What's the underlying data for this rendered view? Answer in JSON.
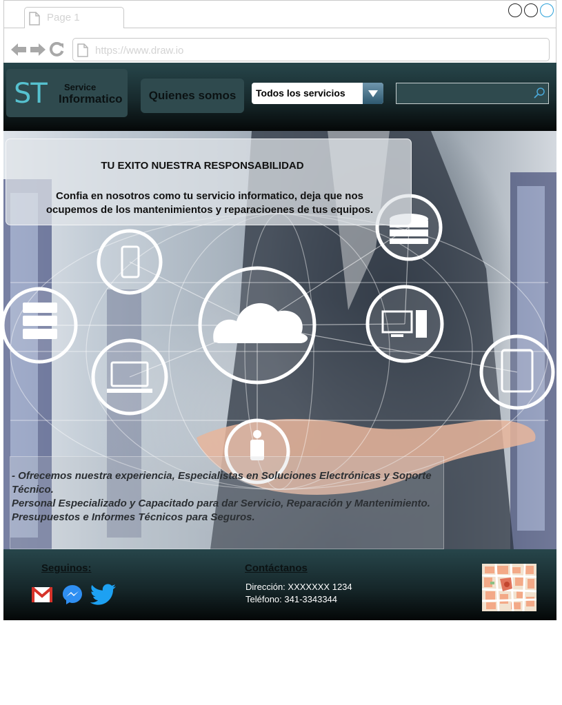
{
  "browser": {
    "tab_label": "Page 1",
    "url": "https://www.draw.io",
    "window_controls": [
      "minimize-icon",
      "maximize-icon",
      "close-icon"
    ]
  },
  "header": {
    "logo_mark": "ST",
    "logo_line1": "Service",
    "logo_line2": "Informatico",
    "nav_button": "Quienes somos",
    "services_select": "Todos los servicios",
    "search_placeholder": ""
  },
  "hero": {
    "headline": "TU EXITO NUESTRA RESPONSABILIDAD",
    "intro_line1": "Confia en nosotros como tu servicio informatico, deja que nos",
    "intro_line2": "ocupemos de los  mantenimientos y reparacioenes de tus equipos.",
    "offer_lines": [
      "- Ofrecemos nuestra experiencia, Especialistas en Soluciones Electrónicas y Soporte Técnico.",
      "Personal Especializado y Capacitado para dar Servicio, Reparación y Mantenimiento.",
      "Presupuestos e Informes Técnicos para Seguros."
    ]
  },
  "footer": {
    "follow_heading": "Seguinos:",
    "social_icons": [
      "gmail-icon",
      "messenger-icon",
      "twitter-icon"
    ],
    "contact_heading": "Contáctanos",
    "address": "Dirección: XXXXXXX 1234",
    "phone": "Teléfono: 341-3343344"
  },
  "colors": {
    "header_dark": "#17292c",
    "panel": "#2f4a4e",
    "logo_accent": "#56c1cf",
    "select_arrow": "#3f6a82"
  }
}
